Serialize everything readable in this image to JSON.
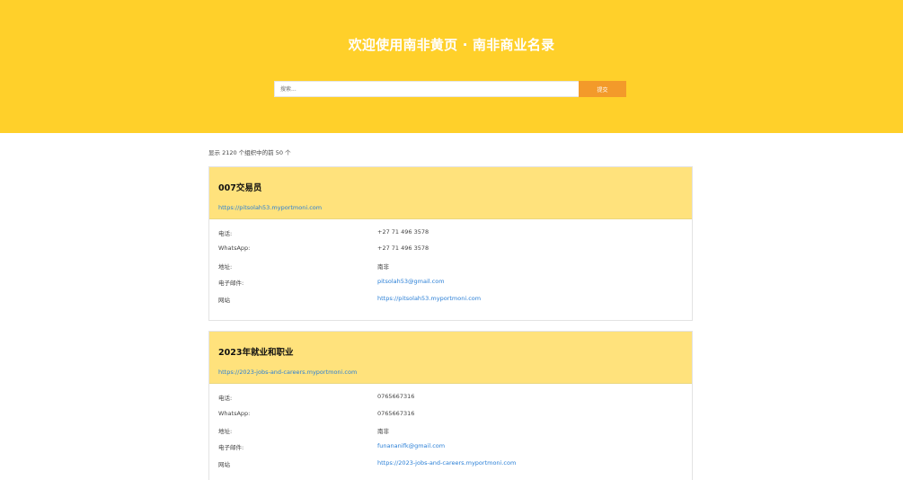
{
  "header": {
    "title": "欢迎使用南非黄页 · 南非商业名录",
    "search_placeholder": "搜索...",
    "submit_label": "提交"
  },
  "results": {
    "summary": "显示 2120 个组织中的前 50 个"
  },
  "labels": {
    "phone": "电话:",
    "whatsapp": "WhatsApp:",
    "address": "地址:",
    "email": "电子邮件:",
    "website": "网站"
  },
  "listings": [
    {
      "name": "007交易员",
      "url": "https://pitsolah53.myportmoni.com",
      "phone": "+27 71 496 3578",
      "whatsapp": "+27 71 496 3578",
      "address": "南非",
      "email": "pitsolah53@gmail.com",
      "website": "https://pitsolah53.myportmoni.com"
    },
    {
      "name": "2023年就业和职业",
      "url": "https://2023-jobs-and-careers.myportmoni.com",
      "phone": "0765667316",
      "whatsapp": "0765667316",
      "address": "南非",
      "email": "funananifk@gmail.com",
      "website": "https://2023-jobs-and-careers.myportmoni.com"
    }
  ],
  "colors": {
    "hero_background": "#ffd02a",
    "card_header_background": "#ffe27c",
    "submit_button": "#f39a2a",
    "link": "#2a7fd6"
  }
}
